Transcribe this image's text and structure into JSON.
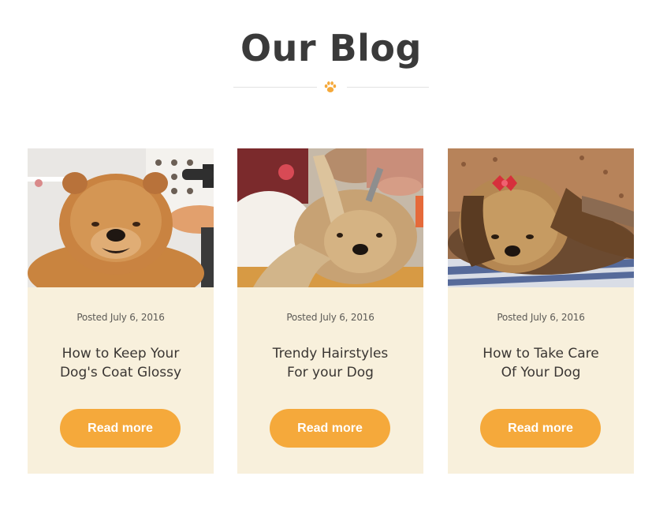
{
  "section": {
    "title": "Our Blog"
  },
  "colors": {
    "accent": "#f5a93b",
    "card_background": "#f8f0dc",
    "divider": "#e3e3e3",
    "title_text": "#3a3a3a"
  },
  "icons": {
    "divider_icon": "paw-icon"
  },
  "posts": [
    {
      "image_subject": "chow-chow-dog-photo",
      "date": "Posted July 6, 2016",
      "title_line1": "How to Keep Your",
      "title_line2": "Dog's Coat Glossy",
      "button_label": "Read more"
    },
    {
      "image_subject": "yorkshire-terrier-grooming-photo",
      "date": "Posted July 6, 2016",
      "title_line1": "Trendy Hairstyles",
      "title_line2": "For your Dog",
      "button_label": "Read more"
    },
    {
      "image_subject": "yorkshire-terrier-with-bow-photo",
      "date": "Posted July 6, 2016",
      "title_line1": "How to Take Care",
      "title_line2": "Of Your Dog",
      "button_label": "Read more"
    }
  ]
}
